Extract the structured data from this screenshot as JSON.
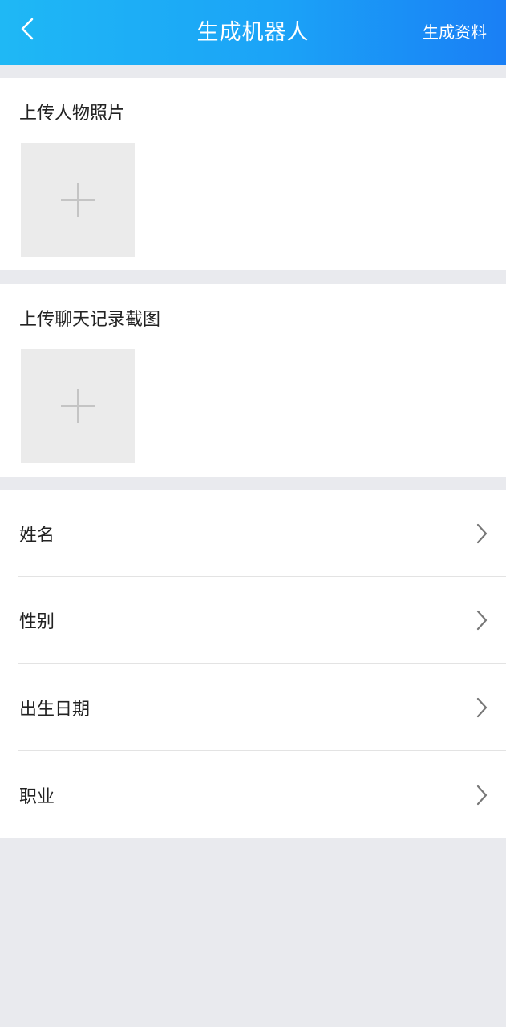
{
  "header": {
    "back_icon": "chevron-left-icon",
    "title": "生成机器人",
    "action_label": "生成资料"
  },
  "photo_upload": {
    "label": "上传人物照片",
    "add_icon": "plus-icon"
  },
  "chat_upload": {
    "label": "上传聊天记录截图",
    "add_icon": "plus-icon"
  },
  "form": {
    "items": [
      {
        "label": "姓名",
        "icon": "chevron-right-icon"
      },
      {
        "label": "性别",
        "icon": "chevron-right-icon"
      },
      {
        "label": "出生日期",
        "icon": "chevron-right-icon"
      },
      {
        "label": "职业",
        "icon": "chevron-right-icon"
      }
    ]
  },
  "colors": {
    "header_gradient_start": "#1fb8f5",
    "header_gradient_end": "#1a7ff5",
    "page_background": "#e9eaee",
    "upload_box": "#ebebeb"
  }
}
